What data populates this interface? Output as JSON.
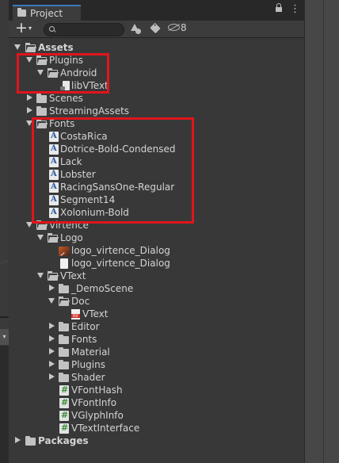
{
  "window": {
    "tab_label": "Project",
    "tab_icon": "folder-icon",
    "lock_icon": "lock-icon",
    "menu_glyph": "⋮"
  },
  "toolbar": {
    "add_glyph": "+",
    "add_caret": "▾",
    "search_value": "",
    "search_placeholder": "",
    "hidden_packages_count": "8"
  },
  "tree": {
    "assets": "Assets",
    "plugins": "Plugins",
    "android": "Android",
    "libvtext": "libVText",
    "scenes": "Scenes",
    "streaming_assets": "StreamingAssets",
    "fonts": {
      "label": "Fonts",
      "items": [
        "CostaRica",
        "Dotrice-Bold-Condensed",
        "Lack",
        "Lobster",
        "RacingSansOne-Regular",
        "Segment14",
        "Xolonium-Bold"
      ]
    },
    "virtence": "Virtence",
    "logo": {
      "label": "Logo",
      "items": [
        "logo_virtence_Dialog",
        "logo_virtence_Dialog"
      ]
    },
    "vtext": {
      "label": "VText",
      "demo_scene": "_DemoScene",
      "doc": "Doc",
      "doc_file": "VText",
      "editor": "Editor",
      "fonts": "Fonts",
      "material": "Material",
      "plugins": "Plugins",
      "shader": "Shader",
      "scripts": [
        "VFontHash",
        "VFontInfo",
        "VGlyphInfo",
        "VTextInterface"
      ]
    },
    "packages": "Packages"
  },
  "colors": {
    "highlight": "#e0151c",
    "panel_bg": "#383838",
    "tab_accent": "#3a79bb"
  }
}
